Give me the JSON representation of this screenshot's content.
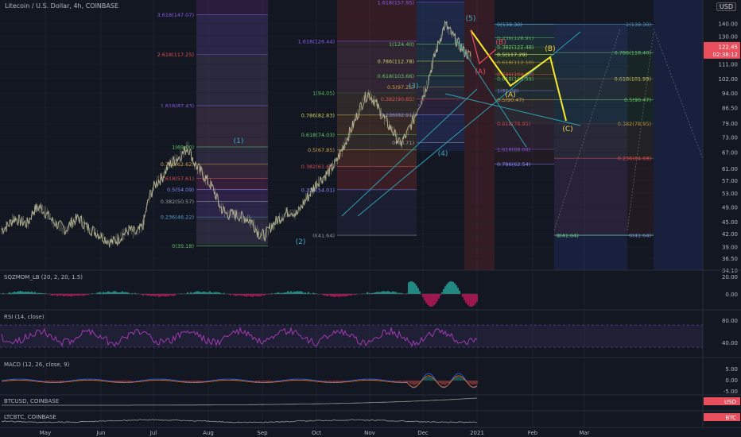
{
  "header": {
    "symbol_title": "Litecoin / U.S. Dollar, 4h, COINBASE",
    "currency_selector": "USD"
  },
  "price_tags": {
    "last_price": "122.45",
    "countdown": "02:38:12"
  },
  "colors": {
    "background": "#131722",
    "grid": "#1e2230",
    "axis_text": "#b2b5be",
    "candle": "#c8c8a0",
    "wave_label": "#3fa7c9",
    "abc_label": "#f6d24a",
    "projection": "#f5ea2c",
    "trend_line": "#2f9fb2",
    "rsi_line": "#b03bbf",
    "price_tag": "#e84e5b"
  },
  "indicators": {
    "sqzmom": {
      "label": "SQZMOM_LB (20, 2, 20, 1.5)",
      "ticks": [
        "20.00",
        "0.00"
      ]
    },
    "rsi": {
      "label": "RSI (14, close)",
      "ticks": [
        "80.00",
        "40.00"
      ]
    },
    "macd": {
      "label": "MACD (12, 26, close, 9)",
      "ticks": [
        "5.00",
        "0.00",
        "-5.00"
      ]
    },
    "btcusd": {
      "label": "BTCUSD, COINBASE",
      "tag": "USD"
    },
    "ltcbtc": {
      "label": "LTCBTC, COINBASE",
      "tag": "BTC"
    }
  },
  "chart_data": {
    "type": "line",
    "title": "Litecoin / U.S. Dollar, 4h, COINBASE",
    "xlabel": "",
    "ylabel": "",
    "x_ticks": [
      "May",
      "Jun",
      "Jul",
      "Aug",
      "Sep",
      "Oct",
      "Nov",
      "Dec",
      "2021",
      "Feb",
      "Mar"
    ],
    "y_scale": "log",
    "ylim": [
      34.1,
      160
    ],
    "y_ticks": [
      "140.00",
      "130.00",
      "122.45",
      "111.00",
      "102.00",
      "94.00",
      "86.50",
      "79.00",
      "73.00",
      "67.00",
      "61.00",
      "57.00",
      "53.00",
      "49.00",
      "45.00",
      "42.00",
      "39.00",
      "36.50",
      "34.10"
    ],
    "series": [
      {
        "values": [
          43,
          44,
          46,
          45,
          44.5,
          48,
          49,
          47,
          45,
          44,
          43,
          45,
          46,
          44,
          43,
          42,
          41,
          40,
          40.5,
          42,
          43,
          42,
          44,
          52,
          56,
          58,
          62,
          64,
          66,
          69,
          63,
          60,
          57,
          54,
          49,
          47,
          47,
          46.5,
          46,
          45,
          42,
          41.64,
          44,
          45.5,
          47,
          48,
          47,
          50,
          53,
          56,
          58,
          60,
          63,
          68,
          74,
          80,
          88,
          94,
          90,
          84,
          79,
          75,
          70,
          74,
          80,
          88,
          96,
          110,
          125,
          139,
          132,
          125,
          119,
          116
        ]
      }
    ],
    "wave_labels": [
      "(1)",
      "(2)",
      "(3)",
      "(4)",
      "(5)"
    ],
    "projection_labels": [
      "(A)",
      "(B)",
      "(C)"
    ],
    "corrective_labels": [
      "(A)",
      "(B)"
    ],
    "fib_retracements": [
      {
        "levels": [
          "3.618(147.07)",
          "2.618(117.25)",
          "1.618(87.43)",
          "1(69.00)",
          "0.786(62.62)",
          "0.618(57.61)",
          "0.5(54.09)",
          "0.382(50.57)",
          "0.236(46.22)",
          "0(39.18)"
        ]
      },
      {
        "levels": [
          "1.618(126.44)",
          "1(94.05)",
          "0.786(82.83)",
          "0.618(74.03)",
          "0.5(67.85)",
          "0.382(61.66)",
          "0.236(54.01)",
          "0(41.64)"
        ]
      },
      {
        "levels": [
          "1.618(157.95)",
          "1(124.40)",
          "0.786(112.78)",
          "0.618(103.66)",
          "0.5(97.25)",
          "0.382(90.85)",
          "0.236(82.91)",
          "0(70.71)"
        ]
      },
      {
        "levels": [
          "0(139.30)",
          "0.236(128.91)",
          "0.382(122.48)",
          "0.5(117.29)",
          "0.618(112.10)",
          "0.786(104.70)",
          "1(95.26)",
          "1.618(68.08)"
        ]
      },
      {
        "levels": [
          "0(139.30)",
          "0.382(122.48)",
          "0.5(117.29)",
          "0.618(101.99)",
          "0.5(90.47)",
          "0.618(78.95)",
          "0.786(62.54)"
        ]
      },
      {
        "levels": [
          "1(139.30)",
          "0.786(118.40)",
          "0.618(101.99)",
          "0.5(90.47)",
          "0.382(78.95)",
          "0.236(64.69)",
          "0(41.64)"
        ]
      },
      {
        "levels": [
          "1(41.64)",
          "0(41.64)"
        ]
      }
    ]
  }
}
